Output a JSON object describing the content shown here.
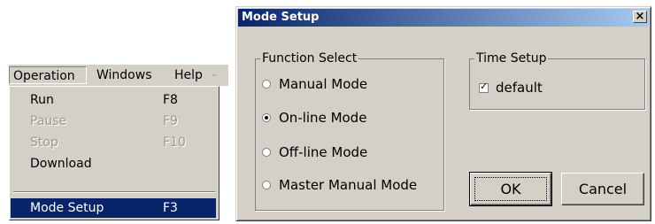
{
  "menubar": {
    "items": [
      {
        "label": "Operation"
      },
      {
        "label": "Windows"
      },
      {
        "label": "Help"
      }
    ],
    "help_arrow": "-"
  },
  "menu": {
    "items": [
      {
        "label": "Run",
        "shortcut": "F8",
        "enabled": true
      },
      {
        "label": "Pause",
        "shortcut": "F9",
        "enabled": false
      },
      {
        "label": "Stop",
        "shortcut": "F10",
        "enabled": false
      },
      {
        "label": "Download",
        "shortcut": "",
        "enabled": true
      },
      {
        "label": "Mode Setup",
        "shortcut": "F3",
        "enabled": true,
        "selected": true
      }
    ]
  },
  "dialog": {
    "title": "Mode Setup",
    "close_glyph": "×",
    "function_select": {
      "legend": "Function Select",
      "options": [
        {
          "label": "Manual Mode",
          "checked": false
        },
        {
          "label": "On-line Mode",
          "checked": true
        },
        {
          "label": "Off-line Mode",
          "checked": false
        },
        {
          "label": "Master Manual Mode",
          "checked": false
        }
      ]
    },
    "time_setup": {
      "legend": "Time Setup",
      "checkbox_label": "default",
      "checked": true,
      "check_glyph": "✓"
    },
    "ok_label": "OK",
    "cancel_label": "Cancel"
  },
  "colors": {
    "face": "#d4d0c8",
    "highlight": "#0a246a",
    "title_gradient_end": "#a6caf0"
  }
}
